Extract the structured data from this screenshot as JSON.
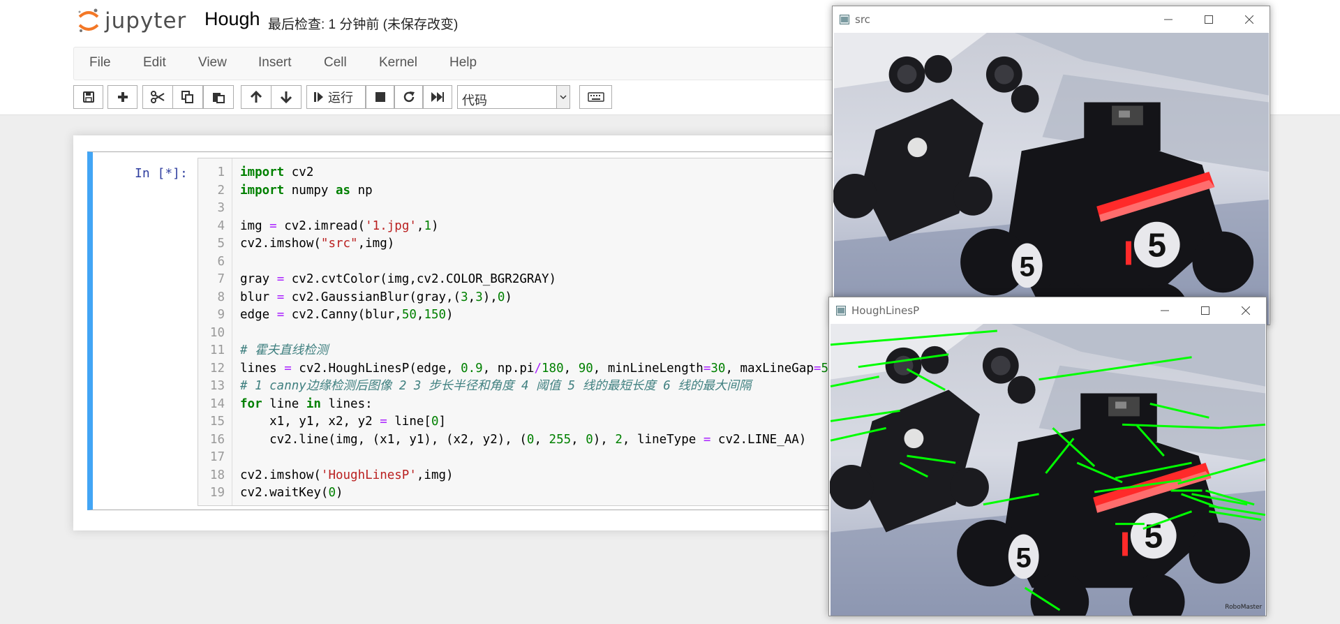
{
  "header": {
    "logo_text": "jupyter",
    "notebook_title": "Hough",
    "checkpoint": "最后检查: 1 分钟前  (未保存改变)"
  },
  "menu": [
    "File",
    "Edit",
    "View",
    "Insert",
    "Cell",
    "Kernel",
    "Help"
  ],
  "toolbar": {
    "run_label": "运行",
    "cell_type": "代码",
    "icons": [
      "save-icon",
      "plus-icon",
      "cut-icon",
      "copy-icon",
      "paste-icon",
      "arrow-up-icon",
      "arrow-down-icon",
      "step-forward-icon",
      "stop-icon",
      "restart-icon",
      "fast-forward-icon",
      "keyboard-icon"
    ]
  },
  "cell": {
    "prompt": "In  [*]:",
    "line_numbers": [
      "1",
      "2",
      "3",
      "4",
      "5",
      "6",
      "7",
      "8",
      "9",
      "10",
      "11",
      "12",
      "13",
      "14",
      "15",
      "16",
      "17",
      "18",
      "19"
    ]
  },
  "windows": {
    "src": {
      "title": "src"
    },
    "hough": {
      "title": "HoughLinesP"
    }
  },
  "image": {
    "robot_number": "5",
    "watermark": "RoboMaster"
  },
  "colors": {
    "accent_blue": "#42a5f5",
    "line_green": "#00ff00",
    "robot_red": "#ff2a2a"
  }
}
